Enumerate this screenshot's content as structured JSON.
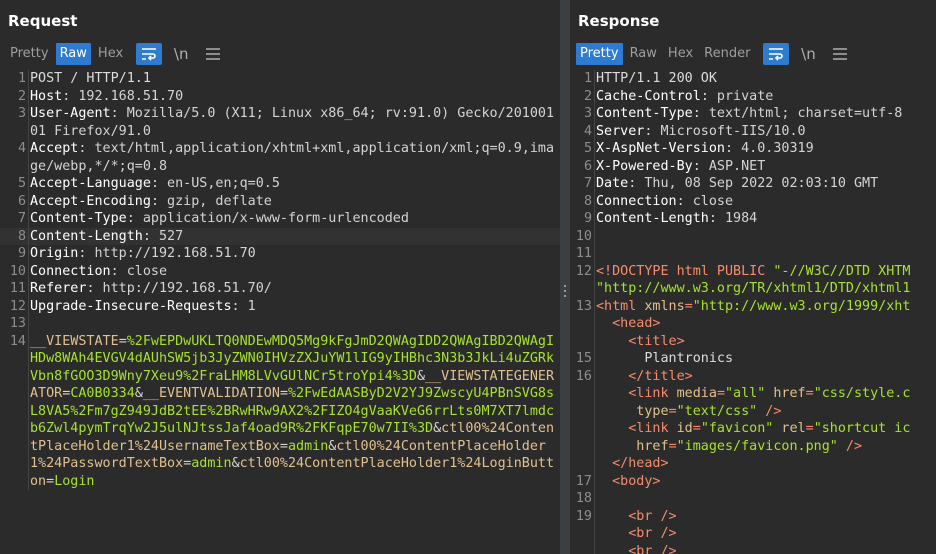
{
  "request": {
    "title": "Request",
    "tabs": [
      "Pretty",
      "Raw",
      "Hex"
    ],
    "active_tab": "Raw",
    "icons": [
      "wrap-icon",
      "newline-icon",
      "menu-icon"
    ],
    "newline_label": "\\n",
    "lines": [
      {
        "n": "1",
        "t": "POST / HTTP/1.1"
      },
      {
        "n": "2",
        "k": "Host",
        "v": " 192.168.51.70"
      },
      {
        "n": "3",
        "k": "User-Agent",
        "v": " Mozilla/5.0 (X11; Linux x86_64; rv:91.0) Gecko/20100101 Firefox/91.0"
      },
      {
        "n": "4",
        "k": "Accept",
        "v": " text/html,application/xhtml+xml,application/xml;q=0.9,image/webp,*/*;q=0.8"
      },
      {
        "n": "5",
        "k": "Accept-Language",
        "v": " en-US,en;q=0.5"
      },
      {
        "n": "6",
        "k": "Accept-Encoding",
        "v": " gzip, deflate"
      },
      {
        "n": "7",
        "k": "Content-Type",
        "v": " application/x-www-form-urlencoded"
      },
      {
        "n": "8",
        "k": "Content-Length",
        "v": " 527",
        "hl": true
      },
      {
        "n": "9",
        "k": "Origin",
        "v": " http://192.168.51.70"
      },
      {
        "n": "10",
        "k": "Connection",
        "v": " close"
      },
      {
        "n": "11",
        "k": "Referer",
        "v": " http://192.168.51.70/"
      },
      {
        "n": "12",
        "k": "Upgrade-Insecure-Requests",
        "v": " 1"
      },
      {
        "n": "13",
        "t": ""
      },
      {
        "n": "14",
        "body": [
          [
            "__VIEWSTATE",
            "%2FwEPDwUKLTQ0NDEwMDQ5Mg9kFgJmD2QWAgIDD2QWAgIBD2QWAgIHDw8WAh4EVGV4dAUhSW5jb3JyZWN0IHVzZXJuYW1lIG9yIHBhc3N3b3JkLi4uZGRkVbn8fGOO3D9Wny7Xeu9%2FraLHM8LVvGUlNCr5troYpi4%3D"
          ],
          [
            "__VIEWSTATEGENERATOR",
            "CA0B0334"
          ],
          [
            "__EVENTVALIDATION",
            "%2FwEdAASByD2V2YJ9ZwscyU4PBnSVG8sL8VA5%2Fm7gZ949JdB2tEE%2BRwHRw9AX2%2FIZO4gVaaKVeG6rrLts0M7XT7lmdcb6Zwl4pymTrqYw2J5ulNJtssJaf4oad9R%2FKFqpE70w7II%3D"
          ],
          [
            "ctl00%24ContentPlaceHolder1%24UsernameTextBox",
            "admin"
          ],
          [
            "ctl00%24ContentPlaceHolder1%24PasswordTextBox",
            "admin"
          ],
          [
            "ctl00%24ContentPlaceHolder1%24LoginButton",
            "Login"
          ]
        ]
      }
    ]
  },
  "response": {
    "title": "Response",
    "tabs": [
      "Pretty",
      "Raw",
      "Hex",
      "Render"
    ],
    "active_tab": "Pretty",
    "icons": [
      "wrap-icon",
      "newline-icon",
      "menu-icon"
    ],
    "newline_label": "\\n",
    "lines": [
      {
        "n": "1",
        "t": "HTTP/1.1 200 OK"
      },
      {
        "n": "2",
        "k": "Cache-Control",
        "v": " private"
      },
      {
        "n": "3",
        "k": "Content-Type",
        "v": " text/html; charset=utf-8"
      },
      {
        "n": "4",
        "k": "Server",
        "v": " Microsoft-IIS/10.0"
      },
      {
        "n": "5",
        "k": "X-AspNet-Version",
        "v": " 4.0.30319"
      },
      {
        "n": "6",
        "k": "X-Powered-By",
        "v": " ASP.NET"
      },
      {
        "n": "7",
        "k": "Date",
        "v": " Thu, 08 Sep 2022 02:03:10 GMT"
      },
      {
        "n": "8",
        "k": "Connection",
        "v": " close"
      },
      {
        "n": "9",
        "k": "Content-Length",
        "v": " 1984"
      },
      {
        "n": "10",
        "t": ""
      },
      {
        "n": "11",
        "t": ""
      },
      {
        "n": "12",
        "html": [
          [
            "tag",
            "<!DOCTYPE html PUBLIC "
          ],
          [
            "str",
            "\"-//W3C//DTD XHTM"
          ]
        ]
      },
      {
        "n": "",
        "html": [
          [
            "str",
            "\"http://www.w3.org/TR/xhtml1/DTD/xhtml1"
          ]
        ]
      },
      {
        "n": "13",
        "html": [
          [
            "tag",
            "<html "
          ],
          [
            "att",
            "xmlns"
          ],
          [
            "tag",
            "="
          ],
          [
            "str",
            "\"http://www.w3.org/1999/xht"
          ]
        ]
      },
      {
        "n": "",
        "html": [
          [
            "tag",
            "  <head>"
          ]
        ]
      },
      {
        "n": "",
        "html": [
          [
            "tag",
            "    <title>"
          ]
        ]
      },
      {
        "n": "15",
        "t": "      Plantronics"
      },
      {
        "n": "16",
        "html": [
          [
            "tag",
            "    </title>"
          ]
        ]
      },
      {
        "n": "",
        "html": [
          [
            "tag",
            "    <link "
          ],
          [
            "att",
            "media"
          ],
          [
            "tag",
            "="
          ],
          [
            "str",
            "\"all\""
          ],
          [
            "att",
            " href"
          ],
          [
            "tag",
            "="
          ],
          [
            "str",
            "\"css/style.c"
          ]
        ]
      },
      {
        "n": "",
        "html": [
          [
            "att",
            "     type"
          ],
          [
            "tag",
            "="
          ],
          [
            "str",
            "\"text/css\""
          ],
          [
            "tag",
            " />"
          ]
        ]
      },
      {
        "n": "",
        "html": [
          [
            "tag",
            "    <link "
          ],
          [
            "att",
            "id"
          ],
          [
            "tag",
            "="
          ],
          [
            "str",
            "\"favicon\""
          ],
          [
            "att",
            " rel"
          ],
          [
            "tag",
            "="
          ],
          [
            "str",
            "\"shortcut ic"
          ]
        ]
      },
      {
        "n": "",
        "html": [
          [
            "att",
            "     href"
          ],
          [
            "tag",
            "="
          ],
          [
            "str",
            "\"images/favicon.png\""
          ],
          [
            "tag",
            " />"
          ]
        ]
      },
      {
        "n": "",
        "html": [
          [
            "tag",
            "  </head>"
          ]
        ]
      },
      {
        "n": "17",
        "html": [
          [
            "tag",
            "  <body>"
          ]
        ]
      },
      {
        "n": "18",
        "t": ""
      },
      {
        "n": "19",
        "html": [
          [
            "tag",
            "    <br />"
          ]
        ]
      },
      {
        "n": "",
        "html": [
          [
            "tag",
            "    <br />"
          ]
        ]
      },
      {
        "n": "",
        "html": [
          [
            "tag",
            "    <br />"
          ]
        ]
      }
    ]
  }
}
